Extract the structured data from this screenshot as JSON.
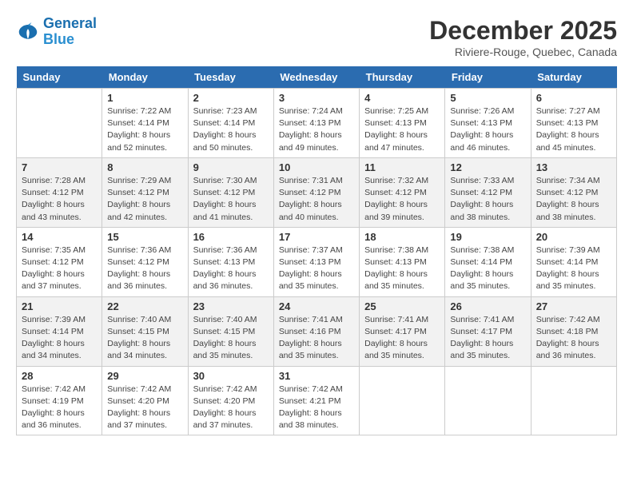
{
  "logo": {
    "line1": "General",
    "line2": "Blue"
  },
  "title": "December 2025",
  "location": "Riviere-Rouge, Quebec, Canada",
  "days_of_week": [
    "Sunday",
    "Monday",
    "Tuesday",
    "Wednesday",
    "Thursday",
    "Friday",
    "Saturday"
  ],
  "weeks": [
    [
      {
        "day": "",
        "info": ""
      },
      {
        "day": "1",
        "info": "Sunrise: 7:22 AM\nSunset: 4:14 PM\nDaylight: 8 hours\nand 52 minutes."
      },
      {
        "day": "2",
        "info": "Sunrise: 7:23 AM\nSunset: 4:14 PM\nDaylight: 8 hours\nand 50 minutes."
      },
      {
        "day": "3",
        "info": "Sunrise: 7:24 AM\nSunset: 4:13 PM\nDaylight: 8 hours\nand 49 minutes."
      },
      {
        "day": "4",
        "info": "Sunrise: 7:25 AM\nSunset: 4:13 PM\nDaylight: 8 hours\nand 47 minutes."
      },
      {
        "day": "5",
        "info": "Sunrise: 7:26 AM\nSunset: 4:13 PM\nDaylight: 8 hours\nand 46 minutes."
      },
      {
        "day": "6",
        "info": "Sunrise: 7:27 AM\nSunset: 4:13 PM\nDaylight: 8 hours\nand 45 minutes."
      }
    ],
    [
      {
        "day": "7",
        "info": "Sunrise: 7:28 AM\nSunset: 4:12 PM\nDaylight: 8 hours\nand 43 minutes."
      },
      {
        "day": "8",
        "info": "Sunrise: 7:29 AM\nSunset: 4:12 PM\nDaylight: 8 hours\nand 42 minutes."
      },
      {
        "day": "9",
        "info": "Sunrise: 7:30 AM\nSunset: 4:12 PM\nDaylight: 8 hours\nand 41 minutes."
      },
      {
        "day": "10",
        "info": "Sunrise: 7:31 AM\nSunset: 4:12 PM\nDaylight: 8 hours\nand 40 minutes."
      },
      {
        "day": "11",
        "info": "Sunrise: 7:32 AM\nSunset: 4:12 PM\nDaylight: 8 hours\nand 39 minutes."
      },
      {
        "day": "12",
        "info": "Sunrise: 7:33 AM\nSunset: 4:12 PM\nDaylight: 8 hours\nand 38 minutes."
      },
      {
        "day": "13",
        "info": "Sunrise: 7:34 AM\nSunset: 4:12 PM\nDaylight: 8 hours\nand 38 minutes."
      }
    ],
    [
      {
        "day": "14",
        "info": "Sunrise: 7:35 AM\nSunset: 4:12 PM\nDaylight: 8 hours\nand 37 minutes."
      },
      {
        "day": "15",
        "info": "Sunrise: 7:36 AM\nSunset: 4:12 PM\nDaylight: 8 hours\nand 36 minutes."
      },
      {
        "day": "16",
        "info": "Sunrise: 7:36 AM\nSunset: 4:13 PM\nDaylight: 8 hours\nand 36 minutes."
      },
      {
        "day": "17",
        "info": "Sunrise: 7:37 AM\nSunset: 4:13 PM\nDaylight: 8 hours\nand 35 minutes."
      },
      {
        "day": "18",
        "info": "Sunrise: 7:38 AM\nSunset: 4:13 PM\nDaylight: 8 hours\nand 35 minutes."
      },
      {
        "day": "19",
        "info": "Sunrise: 7:38 AM\nSunset: 4:14 PM\nDaylight: 8 hours\nand 35 minutes."
      },
      {
        "day": "20",
        "info": "Sunrise: 7:39 AM\nSunset: 4:14 PM\nDaylight: 8 hours\nand 35 minutes."
      }
    ],
    [
      {
        "day": "21",
        "info": "Sunrise: 7:39 AM\nSunset: 4:14 PM\nDaylight: 8 hours\nand 34 minutes."
      },
      {
        "day": "22",
        "info": "Sunrise: 7:40 AM\nSunset: 4:15 PM\nDaylight: 8 hours\nand 34 minutes."
      },
      {
        "day": "23",
        "info": "Sunrise: 7:40 AM\nSunset: 4:15 PM\nDaylight: 8 hours\nand 35 minutes."
      },
      {
        "day": "24",
        "info": "Sunrise: 7:41 AM\nSunset: 4:16 PM\nDaylight: 8 hours\nand 35 minutes."
      },
      {
        "day": "25",
        "info": "Sunrise: 7:41 AM\nSunset: 4:17 PM\nDaylight: 8 hours\nand 35 minutes."
      },
      {
        "day": "26",
        "info": "Sunrise: 7:41 AM\nSunset: 4:17 PM\nDaylight: 8 hours\nand 35 minutes."
      },
      {
        "day": "27",
        "info": "Sunrise: 7:42 AM\nSunset: 4:18 PM\nDaylight: 8 hours\nand 36 minutes."
      }
    ],
    [
      {
        "day": "28",
        "info": "Sunrise: 7:42 AM\nSunset: 4:19 PM\nDaylight: 8 hours\nand 36 minutes."
      },
      {
        "day": "29",
        "info": "Sunrise: 7:42 AM\nSunset: 4:20 PM\nDaylight: 8 hours\nand 37 minutes."
      },
      {
        "day": "30",
        "info": "Sunrise: 7:42 AM\nSunset: 4:20 PM\nDaylight: 8 hours\nand 37 minutes."
      },
      {
        "day": "31",
        "info": "Sunrise: 7:42 AM\nSunset: 4:21 PM\nDaylight: 8 hours\nand 38 minutes."
      },
      {
        "day": "",
        "info": ""
      },
      {
        "day": "",
        "info": ""
      },
      {
        "day": "",
        "info": ""
      }
    ]
  ]
}
